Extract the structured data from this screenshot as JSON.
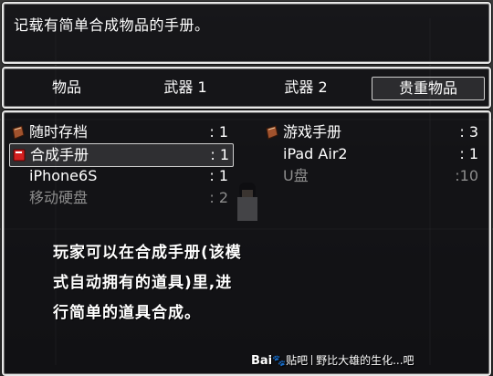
{
  "help_text": "记载有简单合成物品的手册。",
  "categories": [
    {
      "label": "物品",
      "selected": false
    },
    {
      "label": "武器 1",
      "selected": false
    },
    {
      "label": "武器 2",
      "selected": false
    },
    {
      "label": "贵重物品",
      "selected": true
    }
  ],
  "items": [
    {
      "name": "随时存档",
      "count": ": 1",
      "icon": "book-icon",
      "selected": false,
      "disabled": false
    },
    {
      "name": "游戏手册",
      "count": ": 3",
      "icon": "book-icon",
      "selected": false,
      "disabled": false
    },
    {
      "name": "合成手册",
      "count": ": 1",
      "icon": "red-book-icon",
      "selected": true,
      "disabled": false
    },
    {
      "name": "iPad Air2",
      "count": ": 1",
      "icon": "",
      "selected": false,
      "disabled": false
    },
    {
      "name": "iPhone6S",
      "count": ": 1",
      "icon": "",
      "selected": false,
      "disabled": false
    },
    {
      "name": "U盘",
      "count": ":10",
      "icon": "",
      "selected": false,
      "disabled": true
    },
    {
      "name": "移动硬盘",
      "count": ": 2",
      "icon": "",
      "selected": false,
      "disabled": true
    }
  ],
  "annotation": {
    "line1": "玩家可以在合成手册(该模",
    "line2": "式自动拥有的道具)里,进",
    "line3": "行简单的道具合成。"
  },
  "watermark": {
    "logo": "Bai",
    "logo2": "贴吧",
    "text": "野比大雄的生化...吧"
  },
  "colors": {
    "window_border": "#e8e8e8",
    "disabled_text": "#8c8c8c",
    "book_icon": "#a0522d",
    "red_book_icon": "#d42020"
  }
}
